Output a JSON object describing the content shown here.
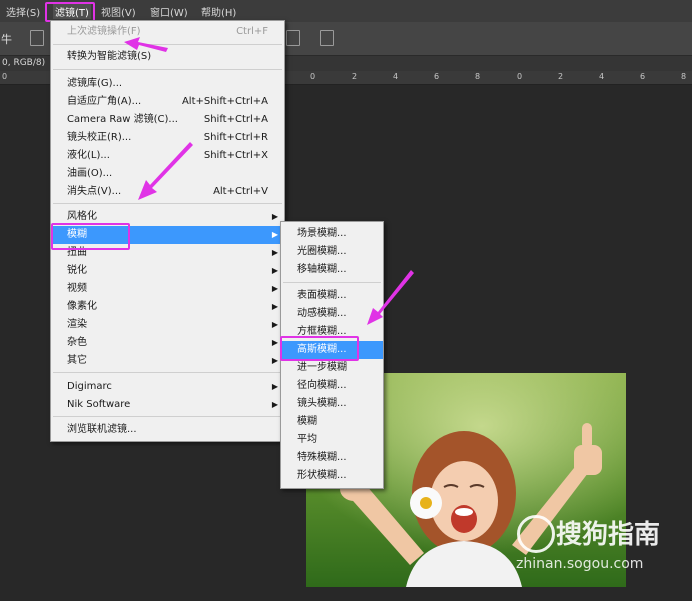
{
  "menubar": {
    "items": [
      "选择(S)",
      "滤镜(T)",
      "视图(V)",
      "窗口(W)",
      "帮助(H)"
    ]
  },
  "toolbar": {
    "left_char": "牛"
  },
  "document": {
    "label": "0, RGB/8)"
  },
  "rulers": {
    "top": [
      "0",
      "2",
      "4",
      "6",
      "8",
      "0",
      "2",
      "4",
      "6",
      "8",
      "0",
      "2",
      "4",
      "6",
      "8",
      "0"
    ]
  },
  "filter_menu": {
    "items": [
      {
        "label": "上次滤镜操作(F)",
        "shortcut": "Ctrl+F",
        "disabled": true
      },
      {
        "label": "转换为智能滤镜(S)",
        "shortcut": ""
      },
      {
        "label": "滤镜库(G)...",
        "shortcut": ""
      },
      {
        "label": "自适应广角(A)...",
        "shortcut": "Alt+Shift+Ctrl+A"
      },
      {
        "label": "Camera Raw 滤镜(C)...",
        "shortcut": "Shift+Ctrl+A"
      },
      {
        "label": "镜头校正(R)...",
        "shortcut": "Shift+Ctrl+R"
      },
      {
        "label": "液化(L)...",
        "shortcut": "Shift+Ctrl+X"
      },
      {
        "label": "油画(O)...",
        "shortcut": ""
      },
      {
        "label": "消失点(V)...",
        "shortcut": "Alt+Ctrl+V"
      },
      {
        "label": "风格化",
        "submenu": true
      },
      {
        "label": "模糊",
        "submenu": true,
        "highlighted": true
      },
      {
        "label": "扭曲",
        "submenu": true
      },
      {
        "label": "锐化",
        "submenu": true
      },
      {
        "label": "视频",
        "submenu": true
      },
      {
        "label": "像素化",
        "submenu": true
      },
      {
        "label": "渲染",
        "submenu": true
      },
      {
        "label": "杂色",
        "submenu": true
      },
      {
        "label": "其它",
        "submenu": true
      },
      {
        "label": "Digimarc",
        "submenu": true
      },
      {
        "label": "Nik Software",
        "submenu": true
      },
      {
        "label": "浏览联机滤镜..."
      }
    ]
  },
  "blur_submenu": {
    "items": [
      {
        "label": "场景模糊..."
      },
      {
        "label": "光圈模糊..."
      },
      {
        "label": "移轴模糊..."
      },
      {
        "label": "表面模糊..."
      },
      {
        "label": "动感模糊..."
      },
      {
        "label": "方框模糊..."
      },
      {
        "label": "高斯模糊...",
        "highlighted": true
      },
      {
        "label": "进一步模糊"
      },
      {
        "label": "径向模糊..."
      },
      {
        "label": "镜头模糊..."
      },
      {
        "label": "模糊"
      },
      {
        "label": "平均"
      },
      {
        "label": "特殊模糊..."
      },
      {
        "label": "形状模糊..."
      }
    ]
  },
  "watermark": {
    "brand": "搜狗指南",
    "url": "zhinan.sogou.com"
  },
  "colors": {
    "highlight": "#3c98fd",
    "annotation": "#e033e6"
  }
}
